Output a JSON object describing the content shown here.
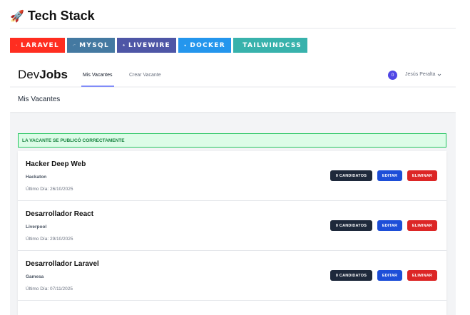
{
  "readme": {
    "title_icon": "rocket-emoji",
    "title": "Tech Stack",
    "badges": [
      {
        "label": "LARAVEL",
        "icon": "laravel-icon",
        "color": "#ff2d20"
      },
      {
        "label": "MYSQL",
        "icon": "mysql-icon",
        "color": "#4479a1"
      },
      {
        "label": "LIVEWIRE",
        "icon": "livewire-icon",
        "color": "#4e56a6"
      },
      {
        "label": "DOCKER",
        "icon": "docker-icon",
        "color": "#2496ed"
      },
      {
        "label": "TAILWINDCSS",
        "icon": "tailwind-icon",
        "color": "#38b2ac"
      }
    ]
  },
  "nav": {
    "logo_prefix": "Dev",
    "logo_bold": "Jobs",
    "links": [
      "Mis Vacantes",
      "Crear Vacante"
    ],
    "active_link": "Mis Vacantes",
    "notification_count": "0",
    "user_name": "Jesús Peralta"
  },
  "header": {
    "title": "Mis Vacantes"
  },
  "alert": {
    "message": "LA VACANTE SE PUBLICÓ CORRECTAMENTE",
    "color": "#15803d"
  },
  "vacancies": [
    {
      "title": "Hacker Deep Web",
      "company": "Hackaton",
      "date": "Último Día: 26/10/2025",
      "candidates_label": "0 CANDIDATOS",
      "edit_label": "EDITAR",
      "delete_label": "ELIMINAR"
    },
    {
      "title": "Desarrollador React",
      "company": "Liverpool",
      "date": "Último Día: 29/10/2025",
      "candidates_label": "0 CANDIDATOS",
      "edit_label": "EDITAR",
      "delete_label": "ELIMINAR"
    },
    {
      "title": "Desarrollador Laravel",
      "company": "Gamesa",
      "date": "Último Día: 07/11/2025",
      "candidates_label": "0 CANDIDATOS",
      "edit_label": "EDITAR",
      "delete_label": "ELIMINAR"
    }
  ]
}
